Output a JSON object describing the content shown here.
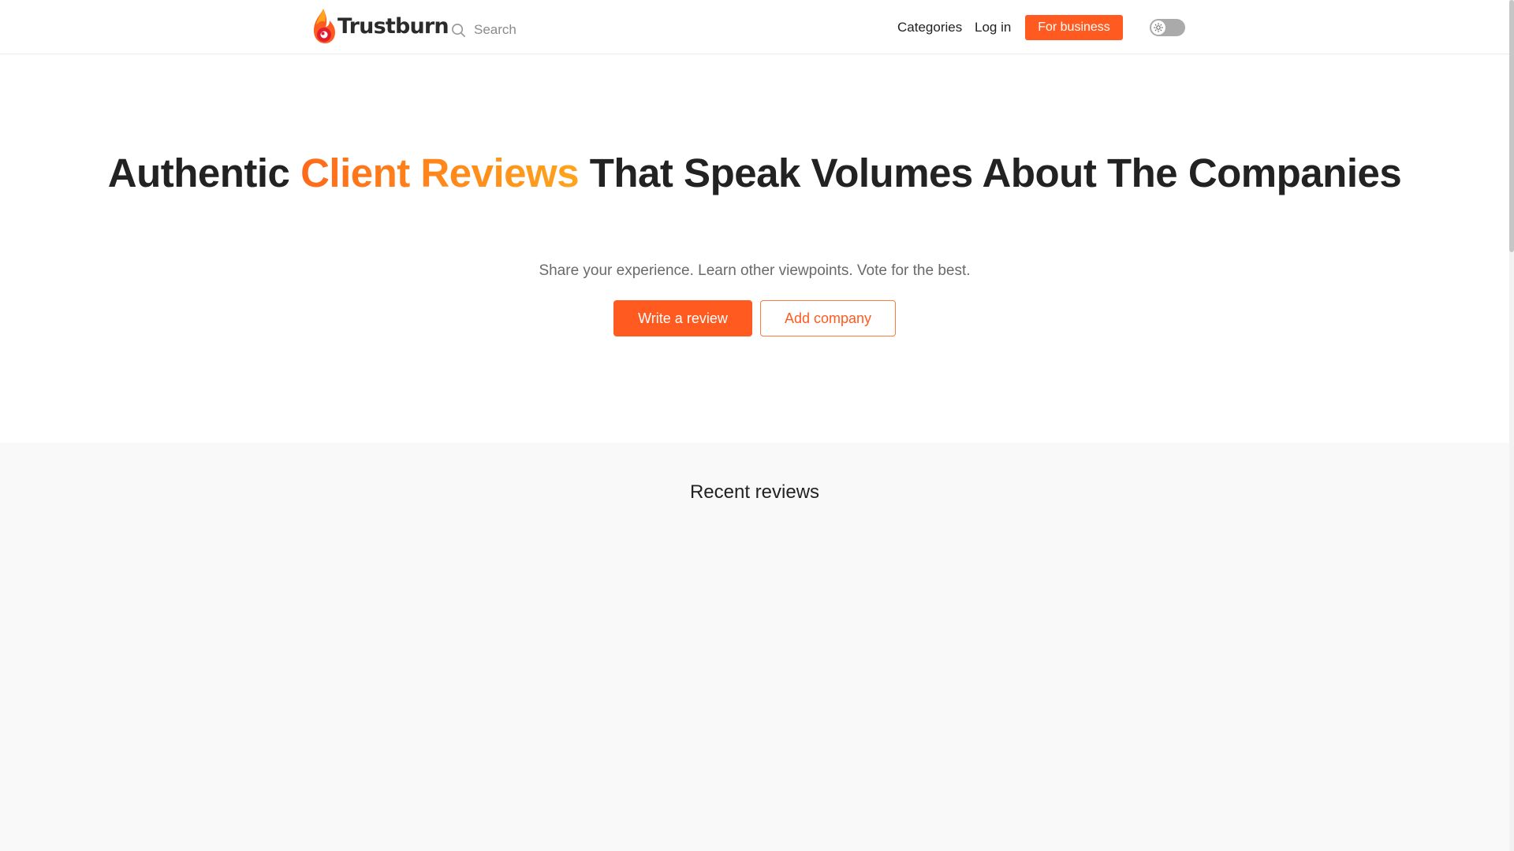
{
  "header": {
    "logo_text": "Trustburn",
    "search_placeholder": "Search",
    "nav": {
      "categories": "Categories",
      "login": "Log in"
    },
    "business_button": "For business",
    "theme_toggle_icon": "sun-icon"
  },
  "hero": {
    "title_before": "Authentic ",
    "title_highlight": "Client Reviews",
    "title_after": " That Speak Volumes About The Companies",
    "subtitle": "Share your experience. Learn other viewpoints. Vote for the best.",
    "primary_button": "Write a review",
    "secondary_button": "Add company"
  },
  "recent": {
    "heading": "Recent reviews"
  },
  "colors": {
    "accent": "#ff5a1f",
    "highlight_gradient_start": "#ff6a1a",
    "highlight_gradient_end": "#ffa41c",
    "section_background": "#f9f9f9"
  }
}
